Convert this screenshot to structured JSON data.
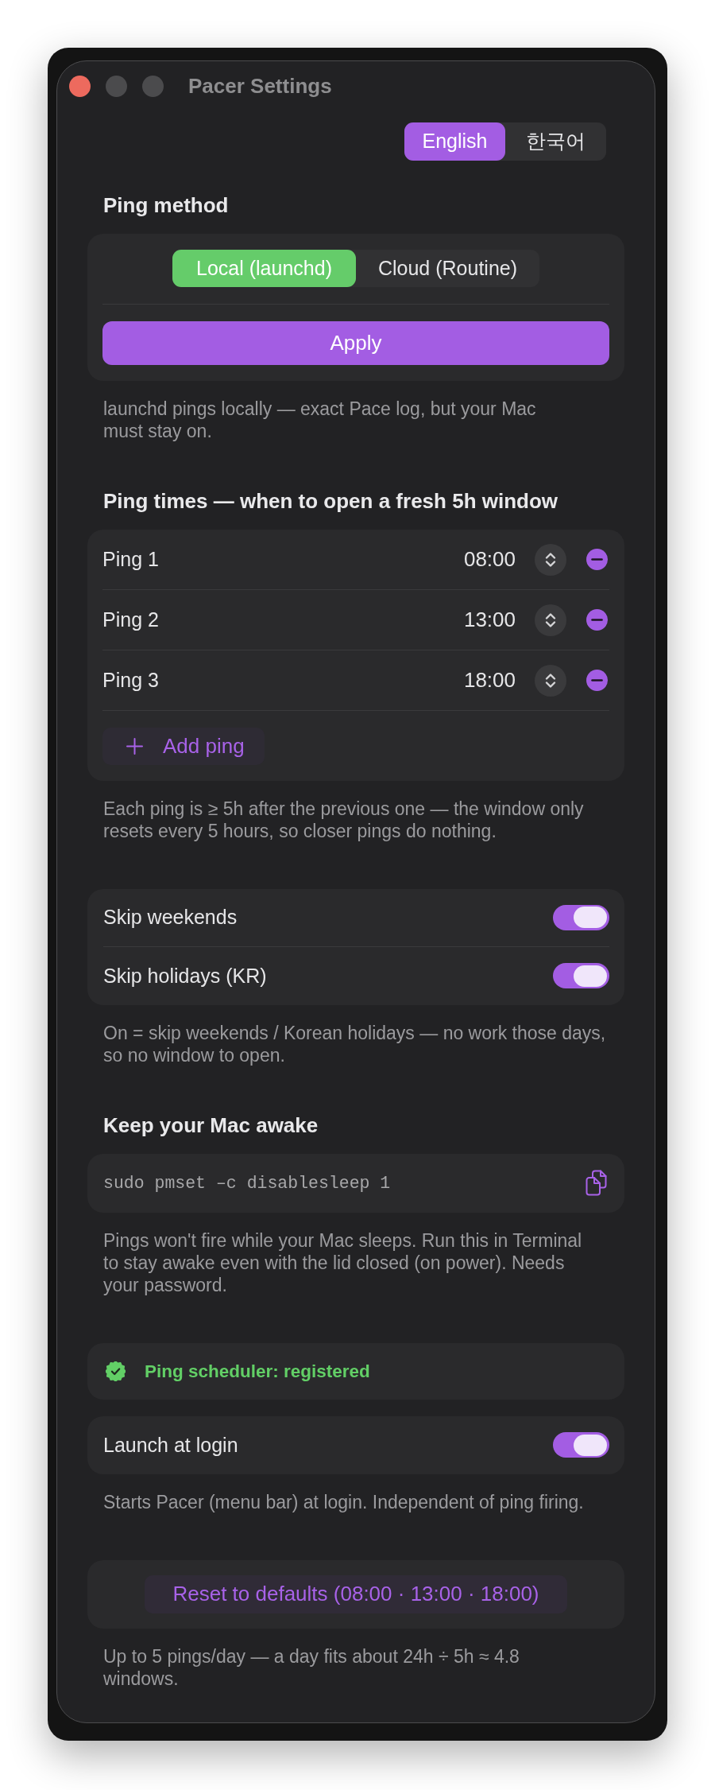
{
  "window": {
    "title": "Pacer Settings",
    "buttons": [
      {
        "kind": "close",
        "disabled": false
      },
      {
        "kind": "minimize",
        "disabled": true
      },
      {
        "kind": "zoom",
        "disabled": true
      }
    ]
  },
  "language": [
    {
      "label": "English",
      "selected": true
    },
    {
      "label": "한국어",
      "selected": false
    }
  ],
  "sections": [
    {
      "heading": "Ping method",
      "cards": [
        {
          "kind": "method",
          "options": [
            {
              "label": "Local (launchd)",
              "selected": true
            },
            {
              "label": "Cloud (Routine)",
              "selected": false
            }
          ],
          "button": "Apply"
        }
      ],
      "note": "launchd pings locally — exact Pace log, but your Mac must stay on."
    },
    {
      "heading": "Ping times — when to open a fresh 5h window",
      "cards": [
        {
          "kind": "pings",
          "rows": [
            {
              "label": "Ping 1",
              "time": "08:00"
            },
            {
              "label": "Ping 2",
              "time": "13:00"
            },
            {
              "label": "Ping 3",
              "time": "18:00"
            }
          ],
          "add_button": "Add ping"
        }
      ],
      "note": "Each ping is ≥ 5h after the previous one — the window only resets every 5 hours, so closer pings do nothing."
    },
    {
      "cards": [
        {
          "kind": "toggles",
          "rows": [
            {
              "label": "Skip weekends",
              "on": true
            },
            {
              "label": "Skip holidays (KR)",
              "on": true
            }
          ]
        }
      ],
      "note": "On = skip weekends / Korean holidays — no work those days, so no window to open."
    },
    {
      "heading": "Keep your Mac awake",
      "cards": [
        {
          "kind": "command",
          "command": "sudo pmset –c disablesleep 1"
        }
      ],
      "note": "Pings won't fire while your Mac sleeps. Run this in Terminal to stay awake even with the lid closed (on power). Needs your password."
    },
    {
      "cards": [
        {
          "kind": "status",
          "text": "Ping scheduler: registered"
        },
        {
          "kind": "toggles",
          "rows": [
            {
              "label": "Launch at login",
              "on": true
            }
          ]
        }
      ],
      "note": "Starts Pacer (menu bar) at login. Independent of ping firing."
    },
    {
      "cards": [
        {
          "kind": "reset",
          "button": "Reset to defaults (08:00 · 13:00 · 18:00)"
        }
      ],
      "note": "Up to 5 pings/day — a day fits about 24h ÷ 5h ≈ 4.8 windows."
    }
  ]
}
